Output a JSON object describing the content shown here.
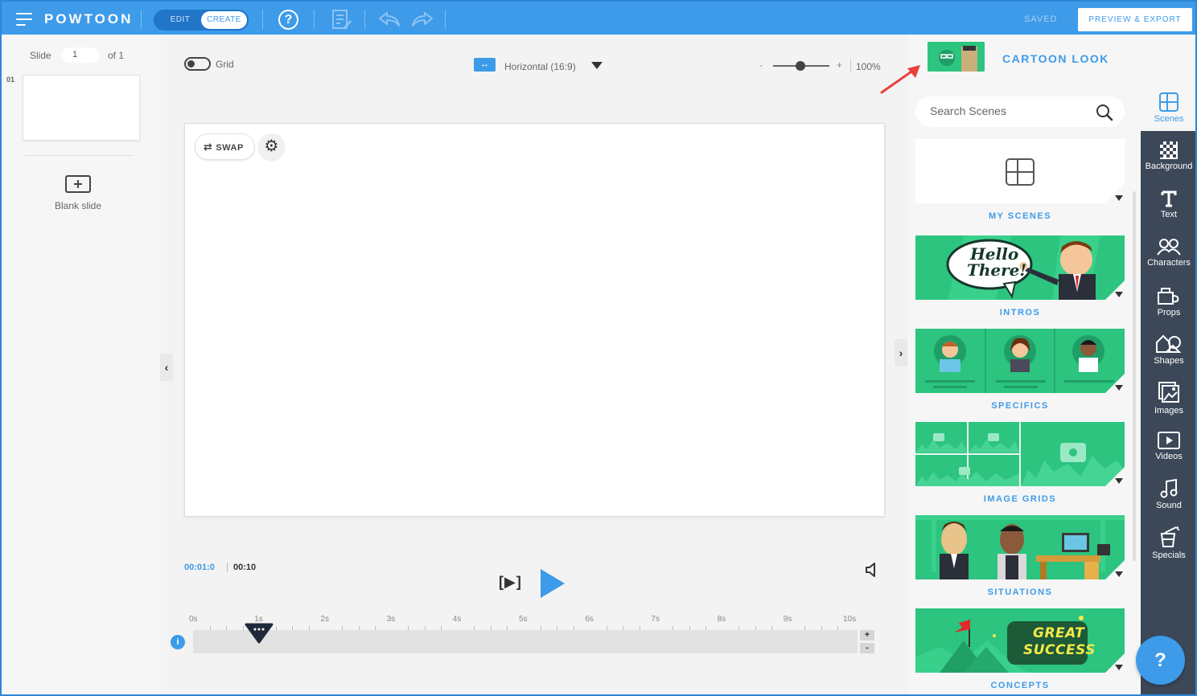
{
  "app": {
    "logo": "POWTOON",
    "mode_edit": "EDIT",
    "mode_create": "CREATE",
    "help": "?",
    "saved": "SAVED",
    "preview_export": "PREVIEW & EXPORT"
  },
  "slides": {
    "label": "Slide",
    "current": "1",
    "of": "of 1",
    "items": [
      {
        "number": "01"
      }
    ],
    "blank_slide": "Blank slide"
  },
  "canvas_toolbar": {
    "grid_label": "Grid",
    "grid_on": false,
    "orientation": "Horizontal (16:9)",
    "zoom_minus": "-",
    "zoom_plus": "+",
    "zoom": "100%"
  },
  "canvas": {
    "swap": "SWAP"
  },
  "timeline": {
    "current_time": "00:01:0",
    "total_time": "00:10",
    "ruler": [
      "0s",
      "1s",
      "2s",
      "3s",
      "4s",
      "5s",
      "6s",
      "7s",
      "8s",
      "9s",
      "10s"
    ],
    "playhead_seconds": 1,
    "info": "i",
    "zoom_in": "+",
    "zoom_out": "-"
  },
  "scene_panel": {
    "style_title": "CARTOON LOOK",
    "search_placeholder": "Search Scenes",
    "categories": [
      {
        "label": "MY SCENES"
      },
      {
        "label": "INTROS"
      },
      {
        "label": "SPECIFICS"
      },
      {
        "label": "IMAGE GRIDS"
      },
      {
        "label": "SITUATIONS"
      },
      {
        "label": "CONCEPTS"
      }
    ],
    "intro_text_1": "Hello",
    "intro_text_2": "There!",
    "concept_text_1": "GREAT",
    "concept_text_2": "SUCCESS"
  },
  "icon_bar": {
    "items": [
      {
        "label": "Scenes",
        "icon": "scenes-icon"
      },
      {
        "label": "Background",
        "icon": "background-icon"
      },
      {
        "label": "Text",
        "icon": "text-icon"
      },
      {
        "label": "Characters",
        "icon": "characters-icon"
      },
      {
        "label": "Props",
        "icon": "props-icon"
      },
      {
        "label": "Shapes",
        "icon": "shapes-icon"
      },
      {
        "label": "Images",
        "icon": "images-icon"
      },
      {
        "label": "Videos",
        "icon": "videos-icon"
      },
      {
        "label": "Sound",
        "icon": "sound-icon"
      },
      {
        "label": "Specials",
        "icon": "specials-icon"
      }
    ],
    "help_fab": "?"
  },
  "colors": {
    "brand_blue": "#3d9be9",
    "scene_green": "#29c67f",
    "toolbar_dark": "#3c4858",
    "annotation_red": "#e8413c"
  }
}
